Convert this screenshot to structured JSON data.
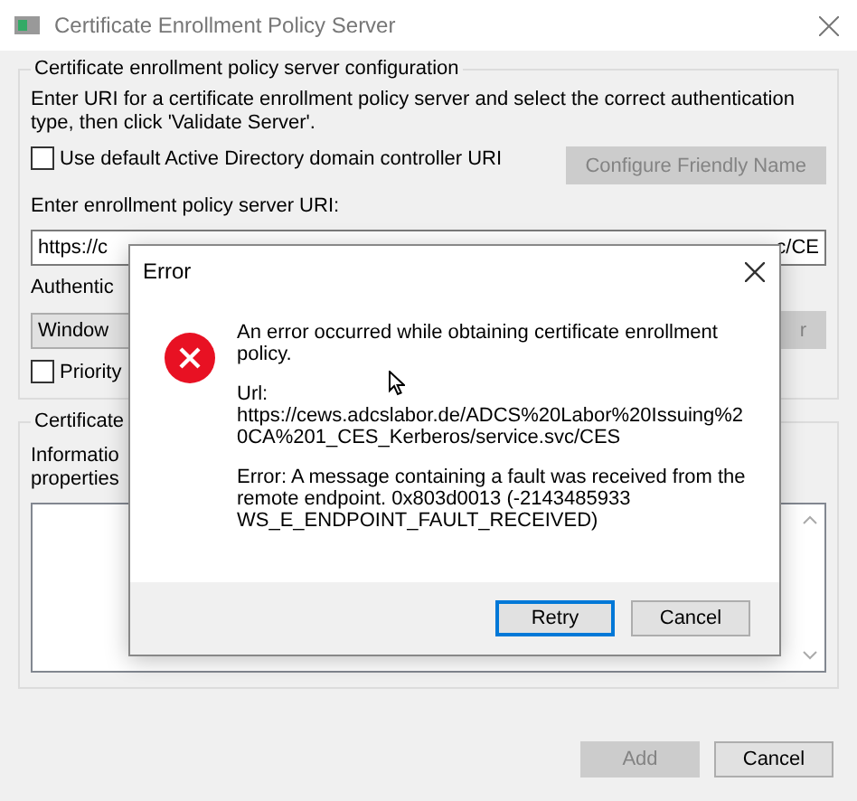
{
  "window": {
    "title": "Certificate Enrollment Policy Server"
  },
  "config_group": {
    "label": "Certificate enrollment policy server configuration",
    "instructions": "Enter URI for a certificate enrollment policy server and select the correct authentication type, then click 'Validate Server'.",
    "use_default_checkbox": {
      "label": "Use default Active Directory domain controller URI",
      "checked": false
    },
    "configure_button": {
      "label": "Configure Friendly Name",
      "disabled": true
    },
    "uri_label": "Enter enrollment policy server URI:",
    "uri_field": {
      "value_start": "https://c",
      "value_end": "c/CE"
    },
    "auth_label": "Authentic",
    "auth_dropdown": {
      "value": "Window"
    },
    "validate_button": {
      "label": "r",
      "disabled": true
    },
    "priority_checkbox": {
      "label": "Priority",
      "checked": false
    }
  },
  "properties_group": {
    "label": "Certificate",
    "info_lines": [
      "Informatio",
      "properties"
    ]
  },
  "buttons": [
    {
      "label": "Add",
      "disabled": true
    },
    {
      "label": "Cancel",
      "disabled": false
    }
  ],
  "error_dialog": {
    "title": "Error",
    "message": "An error occurred while obtaining certificate enrollment policy.",
    "url_label": "Url:",
    "url": "https://cews.adcslabor.de/ADCS%20Labor%20Issuing%20CA%201_CES_Kerberos/service.svc/CES",
    "error": "Error: A message containing a fault was received from the remote endpoint. 0x803d0013 (-2143485933 WS_E_ENDPOINT_FAULT_RECEIVED)",
    "buttons": [
      {
        "label": "Retry",
        "default": true
      },
      {
        "label": "Cancel",
        "default": false
      }
    ]
  }
}
